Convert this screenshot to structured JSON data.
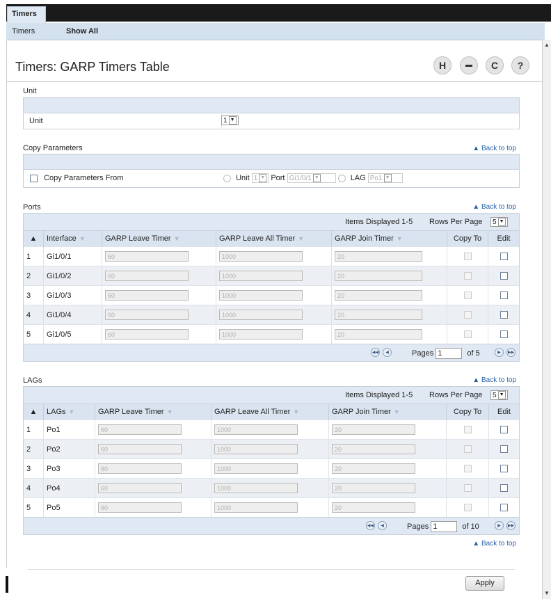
{
  "tabs": {
    "active": "Timers"
  },
  "subnav": {
    "timers": "Timers",
    "show_all": "Show All"
  },
  "page": {
    "title": "Timers: GARP Timers Table"
  },
  "toolbar": {
    "save_glyph": "H",
    "print_glyph": "▬",
    "refresh_glyph": "C",
    "help_glyph": "?"
  },
  "unit_section": {
    "label": "Unit",
    "field_label": "Unit",
    "value": "1"
  },
  "copy_section": {
    "label": "Copy Parameters",
    "back_to_top": "▲ Back to top",
    "checkbox_label": "Copy Parameters From",
    "unit_label": "Unit",
    "unit_value": "1",
    "port_label": "Port",
    "port_value": "Gi1/0/1",
    "lag_label": "LAG",
    "lag_value": "Po1"
  },
  "ports_section": {
    "label": "Ports",
    "back_to_top": "▲ Back to top",
    "items_displayed": "Items Displayed 1-5",
    "rows_per_page_label": "Rows Per Page",
    "rows_per_page": "5",
    "columns": [
      "Interface",
      "GARP Leave Timer",
      "GARP Leave All Timer",
      "GARP Join Timer",
      "Copy To",
      "Edit"
    ],
    "rows": [
      {
        "n": "1",
        "iface": "Gi1/0/1",
        "leave": "60",
        "leaveall": "1000",
        "join": "20"
      },
      {
        "n": "2",
        "iface": "Gi1/0/2",
        "leave": "60",
        "leaveall": "1000",
        "join": "20"
      },
      {
        "n": "3",
        "iface": "Gi1/0/3",
        "leave": "60",
        "leaveall": "1000",
        "join": "20"
      },
      {
        "n": "4",
        "iface": "Gi1/0/4",
        "leave": "60",
        "leaveall": "1000",
        "join": "20"
      },
      {
        "n": "5",
        "iface": "Gi1/0/5",
        "leave": "60",
        "leaveall": "1000",
        "join": "20"
      }
    ],
    "pages_label": "Pages",
    "page_value": "1",
    "of_label": "of 5"
  },
  "lags_section": {
    "label": "LAGs",
    "back_to_top": "▲ Back to top",
    "items_displayed": "Items Displayed 1-5",
    "rows_per_page_label": "Rows Per Page",
    "rows_per_page": "5",
    "columns": [
      "LAGs",
      "GARP Leave Timer",
      "GARP Leave All Timer",
      "GARP Join Timer",
      "Copy To",
      "Edit"
    ],
    "rows": [
      {
        "n": "1",
        "iface": "Po1",
        "leave": "60",
        "leaveall": "1000",
        "join": "20"
      },
      {
        "n": "2",
        "iface": "Po2",
        "leave": "60",
        "leaveall": "1000",
        "join": "20"
      },
      {
        "n": "3",
        "iface": "Po3",
        "leave": "60",
        "leaveall": "1000",
        "join": "20"
      },
      {
        "n": "4",
        "iface": "Po4",
        "leave": "60",
        "leaveall": "1000",
        "join": "20"
      },
      {
        "n": "5",
        "iface": "Po5",
        "leave": "60",
        "leaveall": "1000",
        "join": "20"
      }
    ],
    "pages_label": "Pages",
    "page_value": "1",
    "of_label": "of 10",
    "back_to_top_bottom": "▲ Back to top"
  },
  "footer": {
    "apply_label": "Apply"
  }
}
